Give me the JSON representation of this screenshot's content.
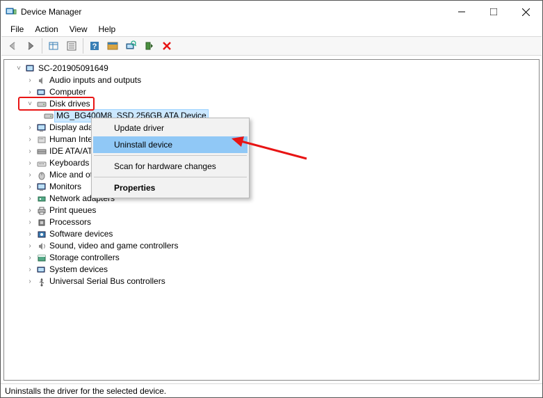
{
  "window": {
    "title": "Device Manager"
  },
  "menu": {
    "file": "File",
    "action": "Action",
    "view": "View",
    "help": "Help"
  },
  "tree": {
    "root": "SC-201905091649",
    "nodes": {
      "audio": "Audio inputs and outputs",
      "computer": "Computer",
      "disk": "Disk drives",
      "disk_child": "MG_BG400M8_SSD 256GB ATA Device",
      "display": "Display adap",
      "hid": "Human Inte",
      "ide": "IDE ATA/ATA",
      "keyboards": "Keyboards",
      "mice": "Mice and ot",
      "monitors": "Monitors",
      "network": "Network adapters",
      "printq": "Print queues",
      "processors": "Processors",
      "software": "Software devices",
      "sound": "Sound, video and game controllers",
      "storage": "Storage controllers",
      "system": "System devices",
      "usb": "Universal Serial Bus controllers"
    }
  },
  "context": {
    "update": "Update driver",
    "uninstall": "Uninstall device",
    "scan": "Scan for hardware changes",
    "properties": "Properties"
  },
  "status": "Uninstalls the driver for the selected device."
}
